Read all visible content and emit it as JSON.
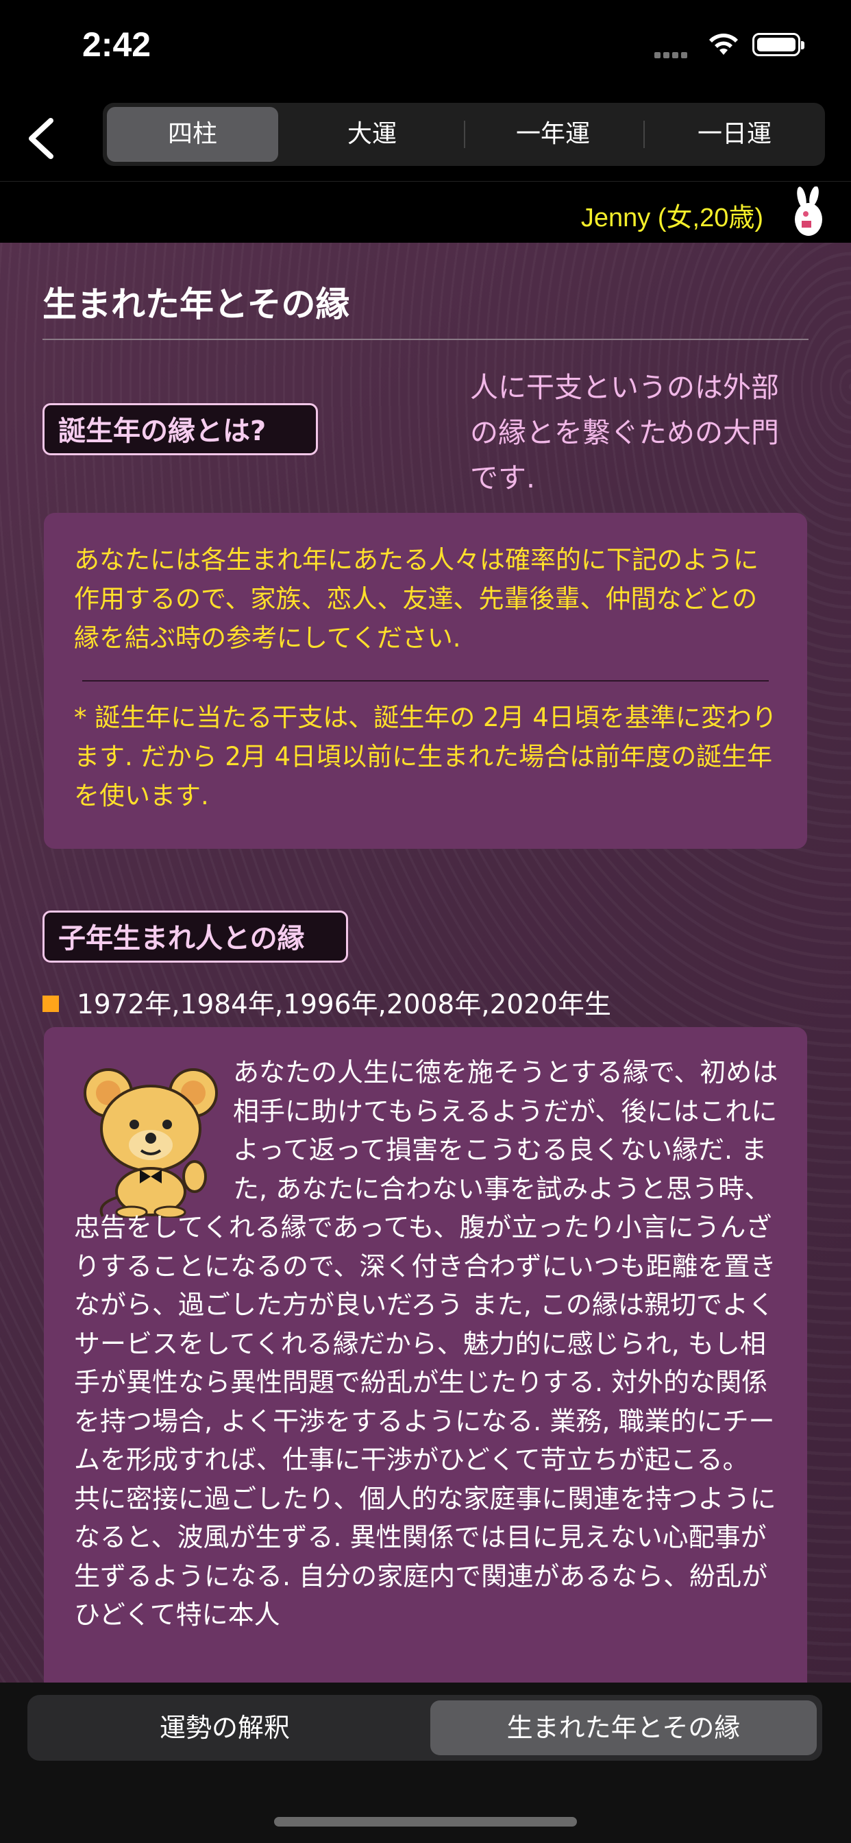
{
  "status": {
    "time": "2:42"
  },
  "tabs": [
    {
      "label": "四柱",
      "active": true
    },
    {
      "label": "大運",
      "active": false
    },
    {
      "label": "一年運",
      "active": false
    },
    {
      "label": "一日運",
      "active": false
    }
  ],
  "user": {
    "name": "Jenny (女,20歳)"
  },
  "section": {
    "title": "生まれた年とその縁",
    "intro_tag": "誕生年の縁とは?",
    "intro_text": "人に干支というのは外部の縁とを繋ぐための大門です.",
    "card_para1": "あなたには各生まれ年にあたる人々は確率的に下記のように作用するので、家族、恋人、友達、先輩後輩、仲間などとの縁を結ぶ時の参考にしてください.",
    "card_para2": "* 誕生年に当たる干支は、誕生年の 2月 4日頃を基準に変わります. だから 2月 4日頃以前に生まれた場合は前年度の誕生年を使います."
  },
  "rat": {
    "tag": "子年生まれ人との縁",
    "years": "1972年,1984年,1996年,2008年,2020年生",
    "text": "あなたの人生に徳を施そうとする縁で、初めは相手に助けてもらえるようだが、後にはこれによって返って損害をこうむる良くない縁だ. また, あなたに合わない事を試みようと思う時、忠告をしてくれる縁であっても、腹が立ったり小言にうんざりすることになるので、深く付き合わずにいつも距離を置きながら、過ごした方が良いだろう また, この縁は親切でよくサービスをしてくれる縁だから、魅力的に感じられ, もし相手が異性なら異性問題で紛乱が生じたりする. 対外的な関係を持つ場合, よく干渉をするようになる. 業務, 職業的にチームを形成すれば、仕事に干渉がひどくて苛立ちが起こる。 共に密接に過ごしたり、個人的な家庭事に関連を持つようになると、波風が生ずる. 異性関係では目に見えない心配事が生ずるようになる. 自分の家庭内で関連があるなら、紛乱がひどくて特に本人"
  },
  "bottom_tabs": [
    {
      "label": "運勢の解釈",
      "active": false
    },
    {
      "label": "生まれた年とその縁",
      "active": true
    }
  ],
  "colors": {
    "accent_yellow": "#ffe02b",
    "pink_text": "#f2b8e8",
    "card_bg": "#6b3564",
    "bullet": "#ffa41a"
  }
}
